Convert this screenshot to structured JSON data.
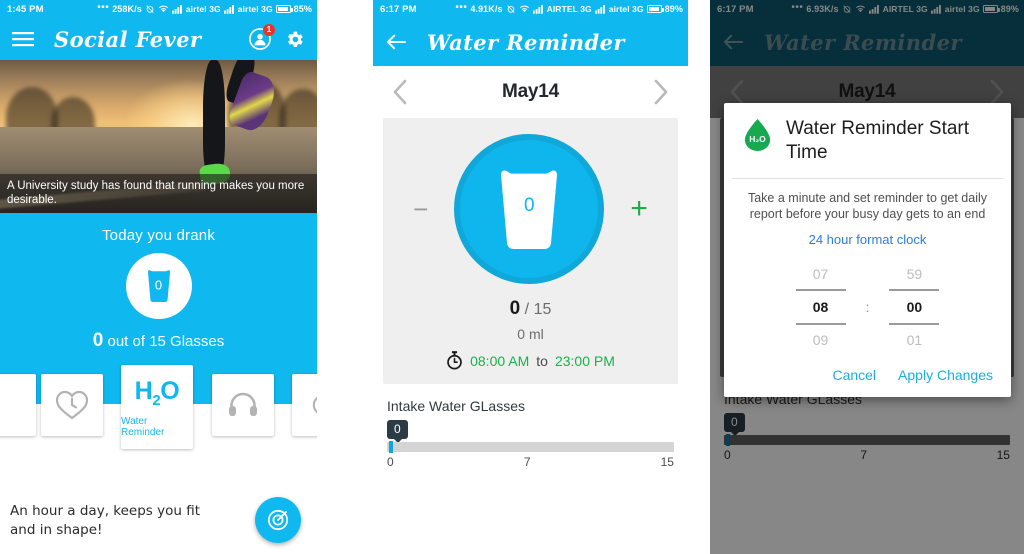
{
  "panel1": {
    "statusbar": {
      "clock": "1:45 PM",
      "dots": "•••",
      "speed": "258K/s",
      "carrier1": "airtel 3G",
      "carrier2": "airtel 3G",
      "battery": "85%"
    },
    "appbar": {
      "title": "Social Fever",
      "menu_icon": "hamburger-menu-icon",
      "profile_icon": "profile-avatar-icon",
      "badge": "1",
      "settings_icon": "gear-icon"
    },
    "hero": {
      "caption": "A University study has found that running makes you more desirable."
    },
    "today": {
      "label": "Today you drank",
      "glass_value": "0",
      "count_value": "0",
      "count_suffix": "out of 15 Glasses"
    },
    "cards": [
      {
        "name": "heart-clock-icon",
        "label": ""
      },
      {
        "name": "h2o-water-reminder",
        "title_main": "H",
        "title_sub": "2",
        "title_tail": "O",
        "label": "Water Reminder"
      },
      {
        "name": "headphones-icon",
        "label": ""
      }
    ],
    "footer": {
      "quote": "An hour a day, keeps you fit and in shape!",
      "fab_icon": "target-icon"
    }
  },
  "panel2": {
    "statusbar": {
      "clock": "6:17 PM",
      "dots": "•••",
      "speed": "4.91K/s",
      "carrier1": "AIRTEL 3G",
      "carrier2": "airtel 3G",
      "battery": "89%"
    },
    "appbar": {
      "title": "Water Reminder",
      "back_icon": "back-arrow-icon"
    },
    "datebar": {
      "prev_icon": "chevron-left-icon",
      "date": "May14",
      "next_icon": "chevron-right-icon"
    },
    "counter": {
      "minus": "−",
      "plus": "+",
      "glass_value": "0"
    },
    "stats": {
      "current": "0",
      "separator": "/",
      "goal": "15",
      "volume": "0 ml",
      "timer_icon": "stopwatch-icon",
      "start_time": "08:00 AM",
      "to": "to",
      "end_time": "23:00 PM"
    },
    "chart": {
      "title": "Intake Water GLasses",
      "bubble": "0",
      "tick_min": "0",
      "tick_mid": "7",
      "tick_max": "15"
    }
  },
  "panel3": {
    "statusbar": {
      "clock": "6:17 PM",
      "dots": "•••",
      "speed": "6.93K/s",
      "carrier1": "AIRTEL 3G",
      "carrier2": "airtel 3G",
      "battery": "89%"
    },
    "appbar": {
      "title": "Water Reminder",
      "back_icon": "back-arrow-icon"
    },
    "datebar": {
      "prev_icon": "chevron-left-icon",
      "date": "May14",
      "next_icon": "chevron-right-icon"
    },
    "dialog": {
      "icon": "water-drop-h2o-icon",
      "icon_text": "H₂O",
      "title": "Water Reminder Start Time",
      "description": "Take a minute and set reminder to get daily report before your busy day gets to an end",
      "format_link": "24 hour format clock",
      "hour_prev": "07",
      "hour_selected": "08",
      "hour_next": "09",
      "colon": ":",
      "minute_prev": "59",
      "minute_selected": "00",
      "minute_next": "01",
      "cancel": "Cancel",
      "apply": "Apply Changes"
    },
    "chart": {
      "title": "Intake Water GLasses",
      "bubble": "0",
      "tick_min": "0",
      "tick_mid": "7",
      "tick_max": "15"
    }
  },
  "colors": {
    "brand_cyan": "#0fb9f0",
    "dim_cyan": "#0d5a70",
    "green": "#17b24a",
    "link_blue": "#2b7de0",
    "dialog_accent": "#19b0e0",
    "drop_green": "#16a94f"
  }
}
